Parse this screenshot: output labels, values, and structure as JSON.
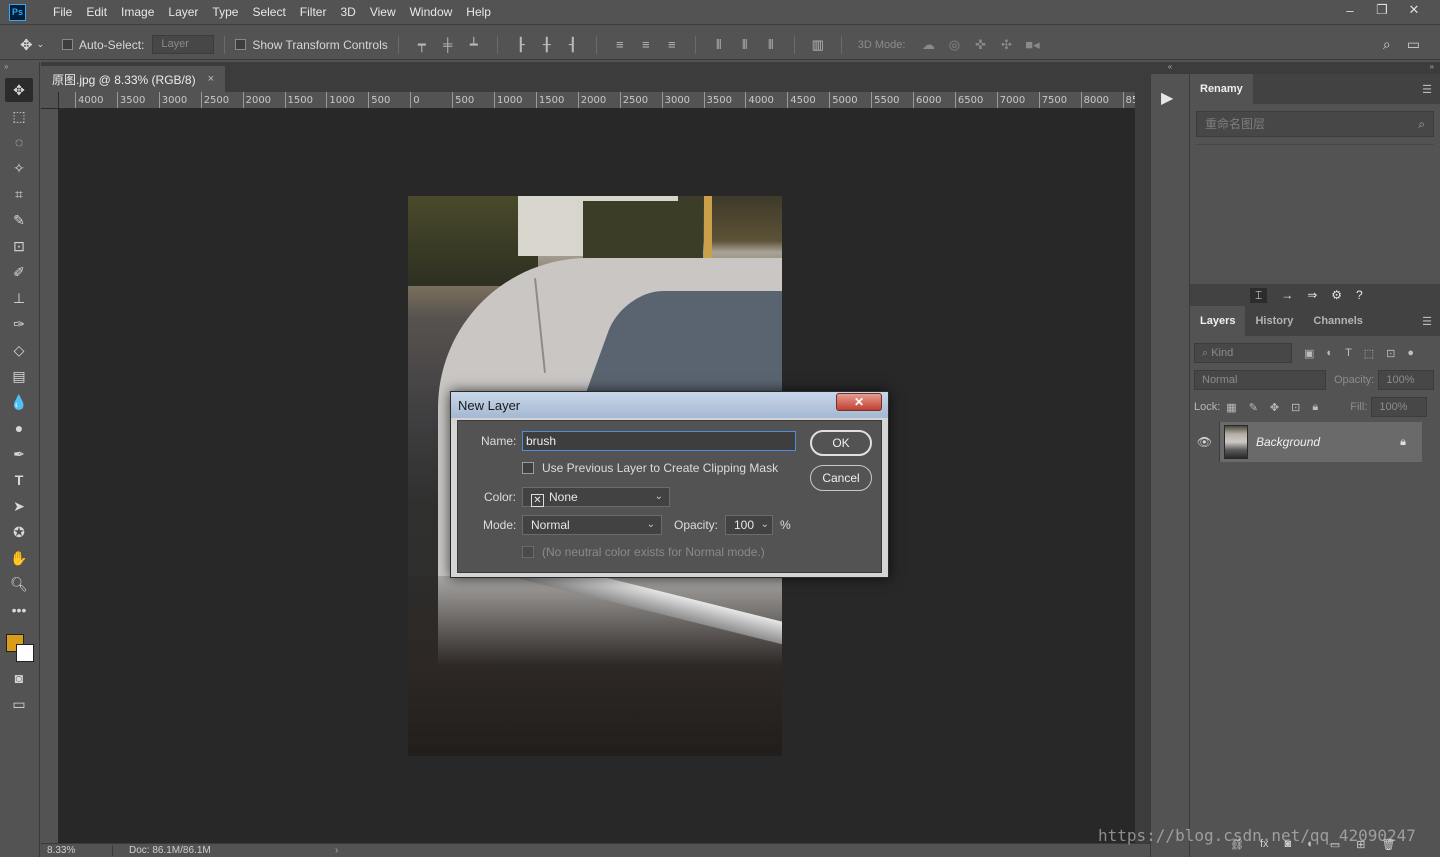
{
  "app": {
    "logo": "Ps"
  },
  "menu": [
    "File",
    "Edit",
    "Image",
    "Layer",
    "Type",
    "Select",
    "Filter",
    "3D",
    "View",
    "Window",
    "Help"
  ],
  "window_controls": {
    "minimize": "–",
    "restore": "❐",
    "close": "✕"
  },
  "options_bar": {
    "auto_select_label": "Auto-Select:",
    "auto_select_target": "Layer",
    "show_transform_label": "Show Transform Controls",
    "mode_3d_label": "3D Mode:"
  },
  "document": {
    "tab_title": "原图.jpg @ 8.33% (RGB/8)",
    "close_glyph": "×"
  },
  "ruler": {
    "h_ticks": [
      "4000",
      "3500",
      "3000",
      "2500",
      "2000",
      "1500",
      "1000",
      "500",
      "0",
      "500",
      "1000",
      "1500",
      "2000",
      "2500",
      "3000",
      "3500",
      "4000",
      "4500",
      "5000",
      "5500",
      "6000",
      "6500",
      "7000",
      "7500",
      "8000",
      "85"
    ]
  },
  "status": {
    "zoom": "8.33%",
    "doc": "Doc: 86.1M/86.1M"
  },
  "renamy_panel": {
    "title": "Renamy",
    "search_placeholder": "重命名图层"
  },
  "layers_panel": {
    "tabs": [
      "Layers",
      "History",
      "Channels"
    ],
    "filter_kind": "Kind",
    "blend_mode": "Normal",
    "opacity_label": "Opacity:",
    "opacity_value": "100%",
    "lock_label": "Lock:",
    "fill_label": "Fill:",
    "fill_value": "100%",
    "layers": [
      {
        "name": "Background",
        "visible": true,
        "locked": true
      }
    ]
  },
  "dialog": {
    "title": "New Layer",
    "close_glyph": "✕",
    "name_label": "Name:",
    "name_value": "brush",
    "clipping_label": "Use Previous Layer to Create Clipping Mask",
    "color_label": "Color:",
    "color_value": "None",
    "mode_label": "Mode:",
    "mode_value": "Normal",
    "opacity_label": "Opacity:",
    "opacity_value": "100",
    "opacity_unit": "%",
    "neutral_label": "(No neutral color exists for Normal mode.)",
    "ok_label": "OK",
    "cancel_label": "Cancel"
  },
  "colors": {
    "foreground": "#d79d1a",
    "background": "#ffffff",
    "accent_focus": "#4c8ee0"
  },
  "watermark": "https://blog.csdn.net/qq_42090247"
}
